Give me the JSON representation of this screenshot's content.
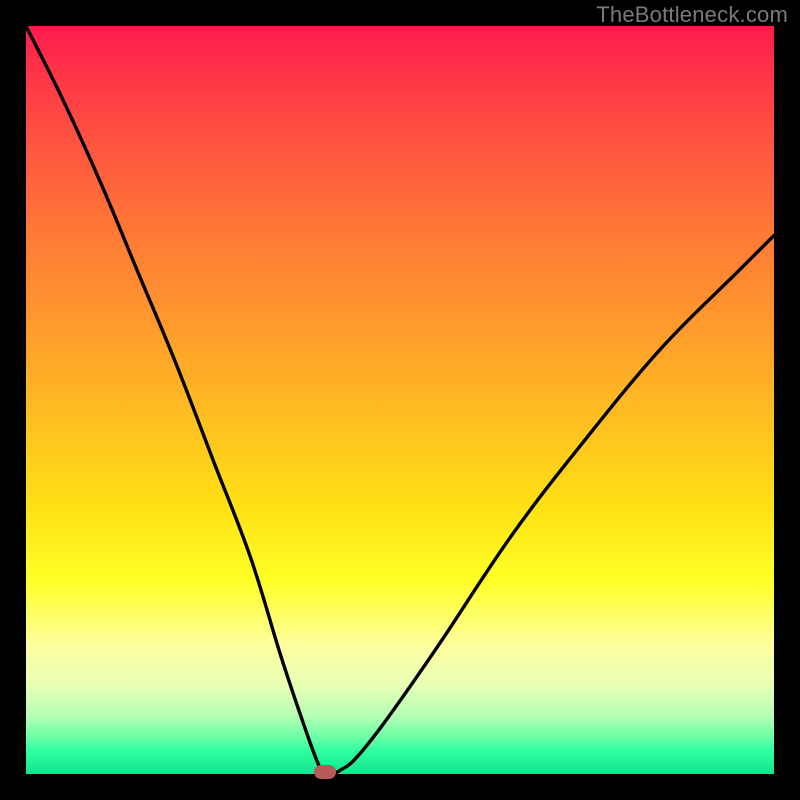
{
  "watermark": "TheBottleneck.com",
  "colors": {
    "frame": "#000000",
    "gradient_top": "#ff1a4d",
    "gradient_bottom": "#16e28e",
    "curve": "#000000",
    "marker": "#b95a5a"
  },
  "chart_data": {
    "type": "line",
    "title": "",
    "xlabel": "",
    "ylabel": "",
    "xlim": [
      0,
      100
    ],
    "ylim": [
      0,
      100
    ],
    "min_point": {
      "x": 40,
      "y": 0
    },
    "series": [
      {
        "name": "bottleneck-curve",
        "x": [
          0,
          5,
          10,
          15,
          20,
          25,
          30,
          34,
          37,
          39,
          40,
          41,
          42,
          44,
          48,
          55,
          65,
          75,
          85,
          95,
          100
        ],
        "y": [
          100,
          90,
          79,
          67,
          55,
          42,
          29,
          16,
          7,
          1.5,
          0,
          0,
          0.5,
          2,
          7,
          17,
          32,
          45,
          57,
          67,
          72
        ]
      }
    ],
    "annotations": [
      {
        "name": "optimal-marker",
        "x": 40,
        "y": 0.3
      }
    ]
  }
}
